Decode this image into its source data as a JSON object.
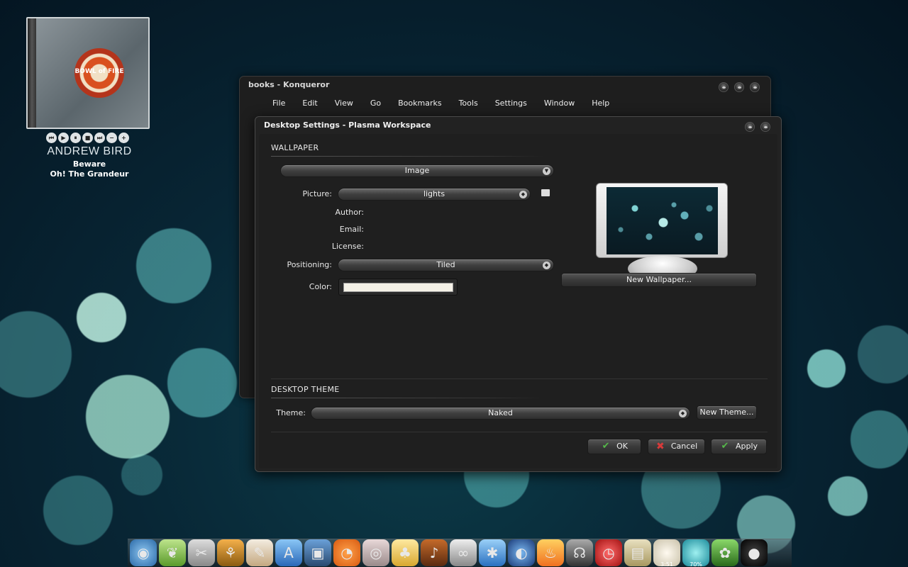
{
  "now_playing": {
    "artist": "ANDREW BIRD",
    "track": "Beware",
    "album": "Oh! The Grandeur",
    "cover_text": "BOWL of FIRE",
    "controls": [
      "prev-icon",
      "play-icon",
      "pause-icon",
      "stop-icon",
      "next-icon",
      "minus-icon",
      "plus-icon"
    ]
  },
  "konqueror": {
    "title": "books - Konqueror",
    "menu": [
      "File",
      "Edit",
      "View",
      "Go",
      "Bookmarks",
      "Tools",
      "Settings",
      "Window",
      "Help"
    ]
  },
  "dialog": {
    "title": "Desktop Settings - Plasma Workspace",
    "wallpaper": {
      "section": "WALLPAPER",
      "type_value": "Image",
      "picture_label": "Picture:",
      "picture_value": "lights",
      "author_label": "Author:",
      "email_label": "Email:",
      "license_label": "License:",
      "positioning_label": "Positioning:",
      "positioning_value": "Tiled",
      "color_label": "Color:",
      "color_value": "#f5f2e8",
      "new_wallpaper": "New Wallpaper..."
    },
    "theme": {
      "section": "DESKTOP THEME",
      "theme_label": "Theme:",
      "theme_value": "Naked",
      "new_theme": "New Theme..."
    },
    "buttons": {
      "ok": "OK",
      "cancel": "Cancel",
      "apply": "Apply"
    }
  },
  "dock": {
    "items": [
      "media-player-icon",
      "leaf-icon",
      "tools-icon",
      "cart-icon",
      "paint-icon",
      "app-store-icon",
      "photos-icon",
      "rss-icon",
      "disc-icon",
      "tux-icon",
      "guitar-icon",
      "link-icon",
      "network-icon",
      "globe-icon",
      "flame-icon",
      "headphones-icon",
      "alarm-icon",
      "chalkboard-icon",
      "clock-icon",
      "weather-icon",
      "plant-icon",
      "speaker-icon"
    ],
    "badges": {
      "clock": "3:51",
      "weather": "70%"
    }
  },
  "colors": {
    "ok_check": "#55b84a",
    "cancel_x": "#d83a3a"
  }
}
